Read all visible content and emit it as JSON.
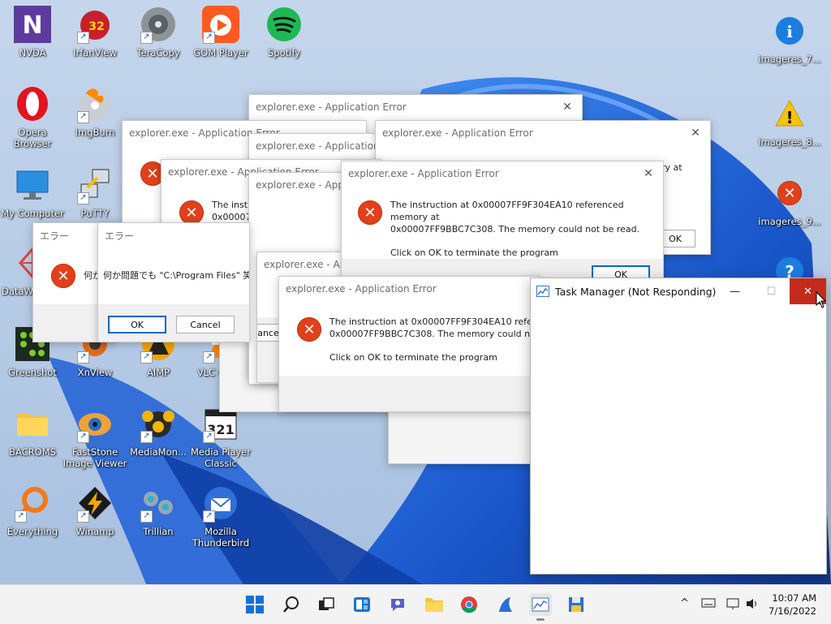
{
  "desktop": {
    "icons": [
      {
        "label": "NVDA"
      },
      {
        "label": "IrfanView",
        "badge": "32"
      },
      {
        "label": "TeraCopy"
      },
      {
        "label": "GOM Player"
      },
      {
        "label": "Spotify"
      },
      {
        "label": "imageres_7..."
      },
      {
        "label": "Opera Browser"
      },
      {
        "label": "ImgBurn"
      },
      {
        "label": "imageres_8..."
      },
      {
        "label": "My Computer"
      },
      {
        "label": "PuTTY"
      },
      {
        "label": "imageres_9..."
      },
      {
        "label": "DataWa"
      },
      {
        "label": "Greenshot"
      },
      {
        "label": "XnView"
      },
      {
        "label": "AIMP"
      },
      {
        "label": "VLC m pla"
      },
      {
        "label": "BACROMS"
      },
      {
        "label": "FastStone Image Viewer"
      },
      {
        "label": "MediaMon..."
      },
      {
        "label": "Media Player Classic",
        "badge": "321"
      },
      {
        "label": "Everything"
      },
      {
        "label": "Winamp"
      },
      {
        "label": "Trillian"
      },
      {
        "label": "Mozilla Thunderbird"
      }
    ]
  },
  "dialogs": {
    "title": "explorer.exe - Application Error",
    "message_line1": "The instruction at 0x00007FF9F304EA10 referenced memory at",
    "message_line2": "0x00007FF9BBC7C308. The memory could not be read.",
    "message_line3": "Click on OK to terminate the program",
    "partial_line1": "The instruction at 0x00007FF9F304EA10 referenced",
    "partial_line2": "0x00007FF9BBC7C308. The memory could not be r",
    "partial_short1": "The instruc",
    "partial_short2": "0x00007FF",
    "partial_right": "ry at",
    "ok_label": "OK",
    "cancel_partial": "ancel",
    "close_glyph": "✕"
  },
  "japanese_dialog": {
    "title": "エラー",
    "message": "何か問題でも \"C:\\Program Files\" 笑",
    "message_partial": "何か",
    "ok_label": "OK",
    "cancel_label": "Cancel"
  },
  "task_manager": {
    "title": "Task Manager (Not Responding)",
    "minimize": "—",
    "maximize": "☐",
    "close": "✕"
  },
  "taskbar": {
    "time": "10:07 AM",
    "date": "7/16/2022",
    "tray_chevron": "^"
  },
  "colors": {
    "error_red": "#e0411b",
    "close_hover": "#c42b1c",
    "taskbar": "#f3f3f3"
  }
}
